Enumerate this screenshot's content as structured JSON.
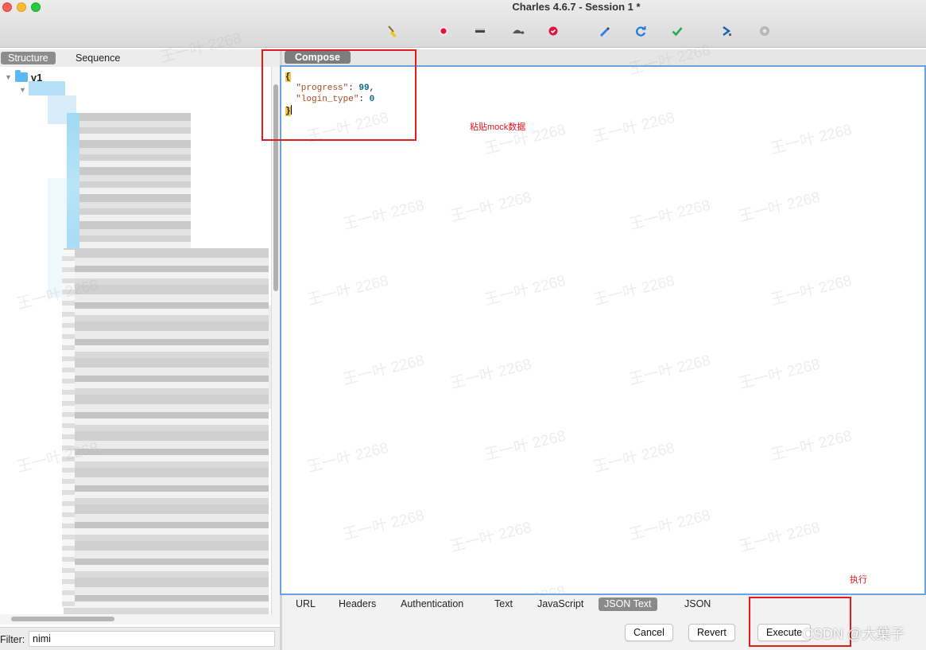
{
  "window": {
    "title": "Charles 4.6.7 - Session 1 *"
  },
  "toolbar": {
    "icons": [
      "broom-icon",
      "record-icon",
      "throttle-icon",
      "turtle-icon",
      "breakpoint-icon",
      "pen-icon",
      "refresh-icon",
      "check-icon",
      "tools-icon",
      "settings-icon"
    ]
  },
  "left_panel": {
    "tabs": [
      "Structure",
      "Sequence"
    ],
    "active_tab": "Structure",
    "tree_root": "v1",
    "filter_label": "Filter:",
    "filter_value": "nimi"
  },
  "right_panel": {
    "compose_tab": "Compose",
    "json_lines": {
      "open": "{",
      "k1": "\"progress\"",
      "v1": "99",
      "k2": "\"login_type\"",
      "v2": "0",
      "close": "}"
    },
    "annotation_paste": "粘贴mock数据",
    "annotation_execute": "执行",
    "bottom_tabs": [
      "URL",
      "Headers",
      "Authentication",
      "Text",
      "JavaScript",
      "JSON Text",
      "JSON"
    ],
    "active_bottom_tab": "JSON Text",
    "buttons": {
      "cancel": "Cancel",
      "revert": "Revert",
      "execute": "Execute"
    }
  },
  "watermark_text": "王一叶 2268",
  "csdn_watermark": "CSDN @大葉子",
  "colors": {
    "annotation_red": "#e21b1b",
    "editor_border": "#6aa3e4",
    "active_tab": "#8a8a8a"
  }
}
